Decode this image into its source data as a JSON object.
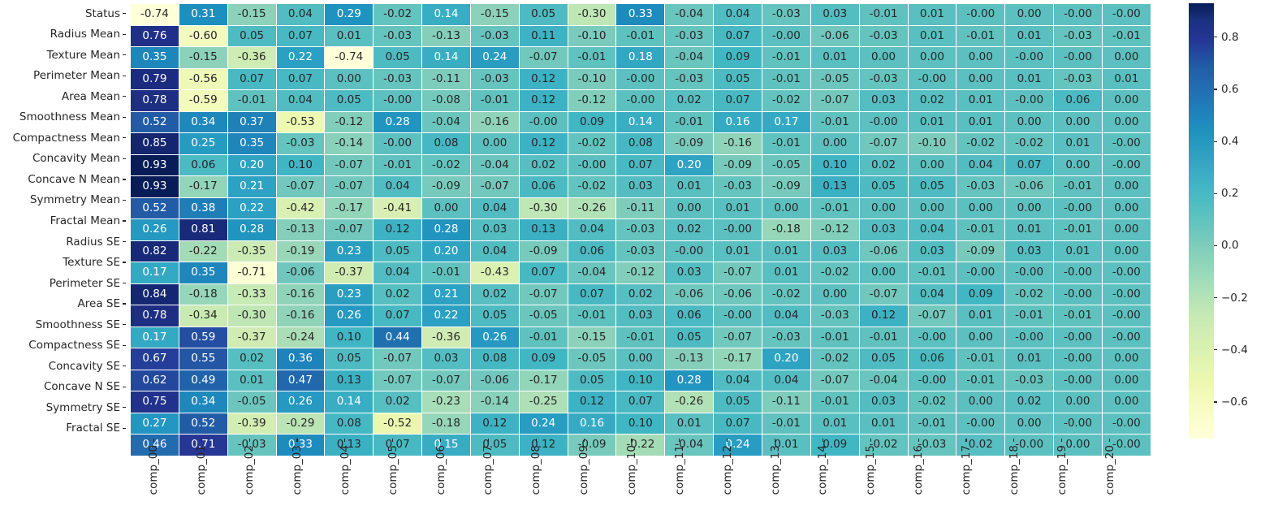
{
  "chart_data": {
    "type": "heatmap",
    "title": "",
    "xlabel": "",
    "ylabel": "",
    "grid": false,
    "colormap": "YlGnBu",
    "value_format": "2 decimal places",
    "colorbar": {
      "position": "right",
      "vmin": -0.74,
      "vmax": 0.93,
      "ticks": [
        "0.8",
        "0.6",
        "0.4",
        "0.2",
        "0.0",
        "−0.2",
        "−0.4",
        "−0.6"
      ],
      "tick_values": [
        0.8,
        0.6,
        0.4,
        0.2,
        0.0,
        -0.2,
        -0.4,
        -0.6
      ],
      "low_color": "#ffffd9",
      "mid_color": "#41b6c4",
      "high_color": "#081d58"
    },
    "x_categories": [
      "comp_00",
      "comp_01",
      "comp_02",
      "comp_03",
      "comp_04",
      "comp_05",
      "comp_06",
      "comp_07",
      "comp_08",
      "comp_09",
      "comp_10",
      "comp_11",
      "comp_12",
      "comp_13",
      "comp_14",
      "comp_15",
      "comp_16",
      "comp_17",
      "comp_18",
      "comp_19",
      "comp_20"
    ],
    "y_categories": [
      "Status",
      "Radius Mean",
      "Texture Mean",
      "Perimeter Mean",
      "Area Mean",
      "Smoothness Mean",
      "Compactness Mean",
      "Concavity Mean",
      "Concave N Mean",
      "Symmetry Mean",
      "Fractal Mean",
      "Radius SE",
      "Texture SE",
      "Perimeter SE",
      "Area SE",
      "Smoothness SE",
      "Compactness SE",
      "Concavity SE",
      "Concave N SE",
      "Symmetry SE",
      "Fractal SE"
    ],
    "values": [
      [
        -0.74,
        0.31,
        -0.15,
        0.04,
        0.29,
        -0.02,
        0.14,
        -0.15,
        0.05,
        -0.3,
        0.33,
        -0.04,
        0.04,
        -0.03,
        0.03,
        -0.01,
        0.01,
        -0.0,
        0.0,
        -0.0,
        -0.0
      ],
      [
        0.76,
        -0.6,
        0.05,
        0.07,
        0.01,
        -0.03,
        -0.13,
        -0.03,
        0.11,
        -0.1,
        -0.01,
        -0.03,
        0.07,
        -0.0,
        -0.06,
        -0.03,
        0.01,
        -0.01,
        0.01,
        -0.03,
        -0.01
      ],
      [
        0.35,
        -0.15,
        -0.36,
        0.22,
        -0.74,
        0.05,
        0.14,
        0.24,
        -0.07,
        -0.01,
        0.18,
        -0.04,
        0.09,
        -0.01,
        0.01,
        0.0,
        0.0,
        0.0,
        -0.0,
        -0.0,
        0.0
      ],
      [
        0.79,
        -0.56,
        0.07,
        0.07,
        0.0,
        -0.03,
        -0.11,
        -0.03,
        0.12,
        -0.1,
        -0.0,
        -0.03,
        0.05,
        -0.01,
        -0.05,
        -0.03,
        -0.0,
        0.0,
        0.01,
        -0.03,
        0.01
      ],
      [
        0.78,
        -0.59,
        -0.01,
        0.04,
        0.05,
        -0.0,
        -0.08,
        -0.01,
        0.12,
        -0.12,
        -0.0,
        0.02,
        0.07,
        -0.02,
        -0.07,
        0.03,
        0.02,
        0.01,
        -0.0,
        0.06,
        0.0
      ],
      [
        0.52,
        0.34,
        0.37,
        -0.53,
        -0.12,
        0.28,
        -0.04,
        -0.16,
        -0.0,
        0.09,
        0.14,
        -0.01,
        0.16,
        0.17,
        -0.01,
        -0.0,
        0.01,
        0.01,
        0.0,
        0.0,
        0.0
      ],
      [
        0.85,
        0.25,
        0.35,
        -0.03,
        -0.14,
        -0.0,
        0.08,
        0.0,
        0.12,
        -0.02,
        0.08,
        -0.09,
        -0.16,
        -0.01,
        0.0,
        -0.07,
        -0.1,
        -0.02,
        -0.02,
        0.01,
        -0.0
      ],
      [
        0.93,
        0.06,
        0.2,
        0.1,
        -0.07,
        -0.01,
        -0.02,
        -0.04,
        0.02,
        -0.0,
        0.07,
        0.2,
        -0.09,
        -0.05,
        0.1,
        0.02,
        0.0,
        0.04,
        0.07,
        0.0,
        -0.0
      ],
      [
        0.93,
        -0.17,
        0.21,
        -0.07,
        -0.07,
        0.04,
        -0.09,
        -0.07,
        0.06,
        -0.02,
        0.03,
        0.01,
        -0.03,
        -0.09,
        0.13,
        0.05,
        0.05,
        -0.03,
        -0.06,
        -0.01,
        0.0
      ],
      [
        0.52,
        0.38,
        0.22,
        -0.42,
        -0.17,
        -0.41,
        0.0,
        0.04,
        -0.3,
        -0.26,
        -0.11,
        0.0,
        0.01,
        0.0,
        -0.01,
        0.0,
        0.0,
        0.0,
        0.0,
        -0.0,
        0.0
      ],
      [
        0.26,
        0.81,
        0.28,
        -0.13,
        -0.07,
        0.12,
        0.28,
        0.03,
        0.13,
        0.04,
        -0.03,
        0.02,
        -0.0,
        -0.18,
        -0.12,
        0.03,
        0.04,
        -0.01,
        0.01,
        -0.01,
        0.0
      ],
      [
        0.82,
        -0.22,
        -0.35,
        -0.19,
        0.23,
        0.05,
        0.2,
        0.04,
        -0.09,
        0.06,
        -0.03,
        -0.0,
        0.01,
        0.01,
        0.03,
        -0.06,
        0.03,
        -0.09,
        0.03,
        0.01,
        0.0
      ],
      [
        0.17,
        0.35,
        -0.71,
        -0.06,
        -0.37,
        0.04,
        -0.01,
        -0.43,
        0.07,
        -0.04,
        -0.12,
        0.03,
        -0.07,
        0.01,
        -0.02,
        0.0,
        -0.01,
        -0.0,
        -0.0,
        -0.0,
        -0.0
      ],
      [
        0.84,
        -0.18,
        -0.33,
        -0.16,
        0.23,
        0.02,
        0.21,
        0.02,
        -0.07,
        0.07,
        0.02,
        -0.06,
        -0.06,
        -0.02,
        0.0,
        -0.07,
        0.04,
        0.09,
        -0.02,
        -0.0,
        -0.0
      ],
      [
        0.78,
        -0.34,
        -0.3,
        -0.16,
        0.26,
        0.07,
        0.22,
        0.05,
        -0.05,
        -0.01,
        0.03,
        0.06,
        -0.0,
        0.04,
        -0.03,
        0.12,
        -0.07,
        0.01,
        -0.01,
        -0.01,
        -0.0
      ],
      [
        0.17,
        0.59,
        -0.37,
        -0.24,
        0.1,
        0.44,
        -0.36,
        0.26,
        -0.01,
        -0.15,
        -0.01,
        0.05,
        -0.07,
        -0.03,
        -0.01,
        -0.01,
        -0.0,
        0.0,
        -0.0,
        -0.0,
        -0.0
      ],
      [
        0.67,
        0.55,
        0.02,
        0.36,
        0.05,
        -0.07,
        0.03,
        0.08,
        0.09,
        -0.05,
        0.0,
        -0.13,
        -0.17,
        0.2,
        -0.02,
        0.05,
        0.06,
        -0.01,
        0.01,
        -0.0,
        0.0
      ],
      [
        0.62,
        0.49,
        0.01,
        0.47,
        0.13,
        -0.07,
        -0.07,
        -0.06,
        -0.17,
        0.05,
        0.1,
        0.28,
        0.04,
        0.04,
        -0.07,
        -0.04,
        -0.0,
        -0.01,
        -0.03,
        -0.0,
        0.0
      ],
      [
        0.75,
        0.34,
        -0.05,
        0.26,
        0.14,
        0.02,
        -0.23,
        -0.14,
        -0.25,
        0.12,
        0.07,
        -0.26,
        0.05,
        -0.11,
        -0.01,
        0.03,
        -0.02,
        0.0,
        0.02,
        0.0,
        0.0
      ],
      [
        0.27,
        0.52,
        -0.39,
        -0.29,
        0.08,
        -0.52,
        -0.18,
        0.12,
        0.24,
        0.16,
        0.1,
        0.01,
        0.07,
        -0.01,
        0.01,
        0.01,
        -0.01,
        -0.0,
        0.0,
        -0.0,
        -0.0
      ],
      [
        0.46,
        0.71,
        -0.03,
        0.33,
        0.13,
        0.07,
        0.15,
        0.05,
        0.12,
        -0.09,
        -0.22,
        -0.04,
        0.24,
        0.01,
        0.09,
        -0.02,
        -0.03,
        0.02,
        -0.0,
        0.0,
        -0.0
      ]
    ],
    "labels": [
      [
        "-0.74",
        "0.31",
        "-0.15",
        "0.04",
        "0.29",
        "-0.02",
        "0.14",
        "-0.15",
        "0.05",
        "-0.30",
        "0.33",
        "-0.04",
        "0.04",
        "-0.03",
        "0.03",
        "-0.01",
        "0.01",
        "-0.00",
        "0.00",
        "-0.00",
        "-0.00"
      ],
      [
        "0.76",
        "-0.60",
        "0.05",
        "0.07",
        "0.01",
        "-0.03",
        "-0.13",
        "-0.03",
        "0.11",
        "-0.10",
        "-0.01",
        "-0.03",
        "0.07",
        "-0.00",
        "-0.06",
        "-0.03",
        "0.01",
        "-0.01",
        "0.01",
        "-0.03",
        "-0.01"
      ],
      [
        "0.35",
        "-0.15",
        "-0.36",
        "0.22",
        "-0.74",
        "0.05",
        "0.14",
        "0.24",
        "-0.07",
        "-0.01",
        "0.18",
        "-0.04",
        "0.09",
        "-0.01",
        "0.01",
        "0.00",
        "0.00",
        "0.00",
        "-0.00",
        "-0.00",
        "0.00"
      ],
      [
        "0.79",
        "-0.56",
        "0.07",
        "0.07",
        "0.00",
        "-0.03",
        "-0.11",
        "-0.03",
        "0.12",
        "-0.10",
        "-0.00",
        "-0.03",
        "0.05",
        "-0.01",
        "-0.05",
        "-0.03",
        "-0.00",
        "0.00",
        "0.01",
        "-0.03",
        "0.01"
      ],
      [
        "0.78",
        "-0.59",
        "-0.01",
        "0.04",
        "0.05",
        "-0.00",
        "-0.08",
        "-0.01",
        "0.12",
        "-0.12",
        "-0.00",
        "0.02",
        "0.07",
        "-0.02",
        "-0.07",
        "0.03",
        "0.02",
        "0.01",
        "-0.00",
        "0.06",
        "0.00"
      ],
      [
        "0.52",
        "0.34",
        "0.37",
        "-0.53",
        "-0.12",
        "0.28",
        "-0.04",
        "-0.16",
        "-0.00",
        "0.09",
        "0.14",
        "-0.01",
        "0.16",
        "0.17",
        "-0.01",
        "-0.00",
        "0.01",
        "0.01",
        "0.00",
        "0.00",
        "0.00"
      ],
      [
        "0.85",
        "0.25",
        "0.35",
        "-0.03",
        "-0.14",
        "-0.00",
        "0.08",
        "0.00",
        "0.12",
        "-0.02",
        "0.08",
        "-0.09",
        "-0.16",
        "-0.01",
        "0.00",
        "-0.07",
        "-0.10",
        "-0.02",
        "-0.02",
        "0.01",
        "-0.00"
      ],
      [
        "0.93",
        "0.06",
        "0.20",
        "0.10",
        "-0.07",
        "-0.01",
        "-0.02",
        "-0.04",
        "0.02",
        "-0.00",
        "0.07",
        "0.20",
        "-0.09",
        "-0.05",
        "0.10",
        "0.02",
        "0.00",
        "0.04",
        "0.07",
        "0.00",
        "-0.00"
      ],
      [
        "0.93",
        "-0.17",
        "0.21",
        "-0.07",
        "-0.07",
        "0.04",
        "-0.09",
        "-0.07",
        "0.06",
        "-0.02",
        "0.03",
        "0.01",
        "-0.03",
        "-0.09",
        "0.13",
        "0.05",
        "0.05",
        "-0.03",
        "-0.06",
        "-0.01",
        "0.00"
      ],
      [
        "0.52",
        "0.38",
        "0.22",
        "-0.42",
        "-0.17",
        "-0.41",
        "0.00",
        "0.04",
        "-0.30",
        "-0.26",
        "-0.11",
        "0.00",
        "0.01",
        "0.00",
        "-0.01",
        "0.00",
        "0.00",
        "0.00",
        "0.00",
        "-0.00",
        "0.00"
      ],
      [
        "0.26",
        "0.81",
        "0.28",
        "-0.13",
        "-0.07",
        "0.12",
        "0.28",
        "0.03",
        "0.13",
        "0.04",
        "-0.03",
        "0.02",
        "-0.00",
        "-0.18",
        "-0.12",
        "0.03",
        "0.04",
        "-0.01",
        "0.01",
        "-0.01",
        "0.00"
      ],
      [
        "0.82",
        "-0.22",
        "-0.35",
        "-0.19",
        "0.23",
        "0.05",
        "0.20",
        "0.04",
        "-0.09",
        "0.06",
        "-0.03",
        "-0.00",
        "0.01",
        "0.01",
        "0.03",
        "-0.06",
        "0.03",
        "-0.09",
        "0.03",
        "0.01",
        "0.00"
      ],
      [
        "0.17",
        "0.35",
        "-0.71",
        "-0.06",
        "-0.37",
        "0.04",
        "-0.01",
        "-0.43",
        "0.07",
        "-0.04",
        "-0.12",
        "0.03",
        "-0.07",
        "0.01",
        "-0.02",
        "0.00",
        "-0.01",
        "-0.00",
        "-0.00",
        "-0.00",
        "-0.00"
      ],
      [
        "0.84",
        "-0.18",
        "-0.33",
        "-0.16",
        "0.23",
        "0.02",
        "0.21",
        "0.02",
        "-0.07",
        "0.07",
        "0.02",
        "-0.06",
        "-0.06",
        "-0.02",
        "0.00",
        "-0.07",
        "0.04",
        "0.09",
        "-0.02",
        "-0.00",
        "-0.00"
      ],
      [
        "0.78",
        "-0.34",
        "-0.30",
        "-0.16",
        "0.26",
        "0.07",
        "0.22",
        "0.05",
        "-0.05",
        "-0.01",
        "0.03",
        "0.06",
        "-0.00",
        "0.04",
        "-0.03",
        "0.12",
        "-0.07",
        "0.01",
        "-0.01",
        "-0.01",
        "-0.00"
      ],
      [
        "0.17",
        "0.59",
        "-0.37",
        "-0.24",
        "0.10",
        "0.44",
        "-0.36",
        "0.26",
        "-0.01",
        "-0.15",
        "-0.01",
        "0.05",
        "-0.07",
        "-0.03",
        "-0.01",
        "-0.01",
        "-0.00",
        "0.00",
        "-0.00",
        "-0.00",
        "-0.00"
      ],
      [
        "0.67",
        "0.55",
        "0.02",
        "0.36",
        "0.05",
        "-0.07",
        "0.03",
        "0.08",
        "0.09",
        "-0.05",
        "0.00",
        "-0.13",
        "-0.17",
        "0.20",
        "-0.02",
        "0.05",
        "0.06",
        "-0.01",
        "0.01",
        "-0.00",
        "0.00"
      ],
      [
        "0.62",
        "0.49",
        "0.01",
        "0.47",
        "0.13",
        "-0.07",
        "-0.07",
        "-0.06",
        "-0.17",
        "0.05",
        "0.10",
        "0.28",
        "0.04",
        "0.04",
        "-0.07",
        "-0.04",
        "-0.00",
        "-0.01",
        "-0.03",
        "-0.00",
        "0.00"
      ],
      [
        "0.75",
        "0.34",
        "-0.05",
        "0.26",
        "0.14",
        "0.02",
        "-0.23",
        "-0.14",
        "-0.25",
        "0.12",
        "0.07",
        "-0.26",
        "0.05",
        "-0.11",
        "-0.01",
        "0.03",
        "-0.02",
        "0.00",
        "0.02",
        "0.00",
        "0.00"
      ],
      [
        "0.27",
        "0.52",
        "-0.39",
        "-0.29",
        "0.08",
        "-0.52",
        "-0.18",
        "0.12",
        "0.24",
        "0.16",
        "0.10",
        "0.01",
        "0.07",
        "-0.01",
        "0.01",
        "0.01",
        "-0.01",
        "-0.00",
        "0.00",
        "-0.00",
        "-0.00"
      ],
      [
        "0.46",
        "0.71",
        "-0.03",
        "0.33",
        "0.13",
        "0.07",
        "0.15",
        "0.05",
        "0.12",
        "-0.09",
        "-0.22",
        "-0.04",
        "0.24",
        "0.01",
        "0.09",
        "-0.02",
        "-0.03",
        "0.02",
        "-0.00",
        "0.00",
        "-0.00"
      ]
    ]
  }
}
